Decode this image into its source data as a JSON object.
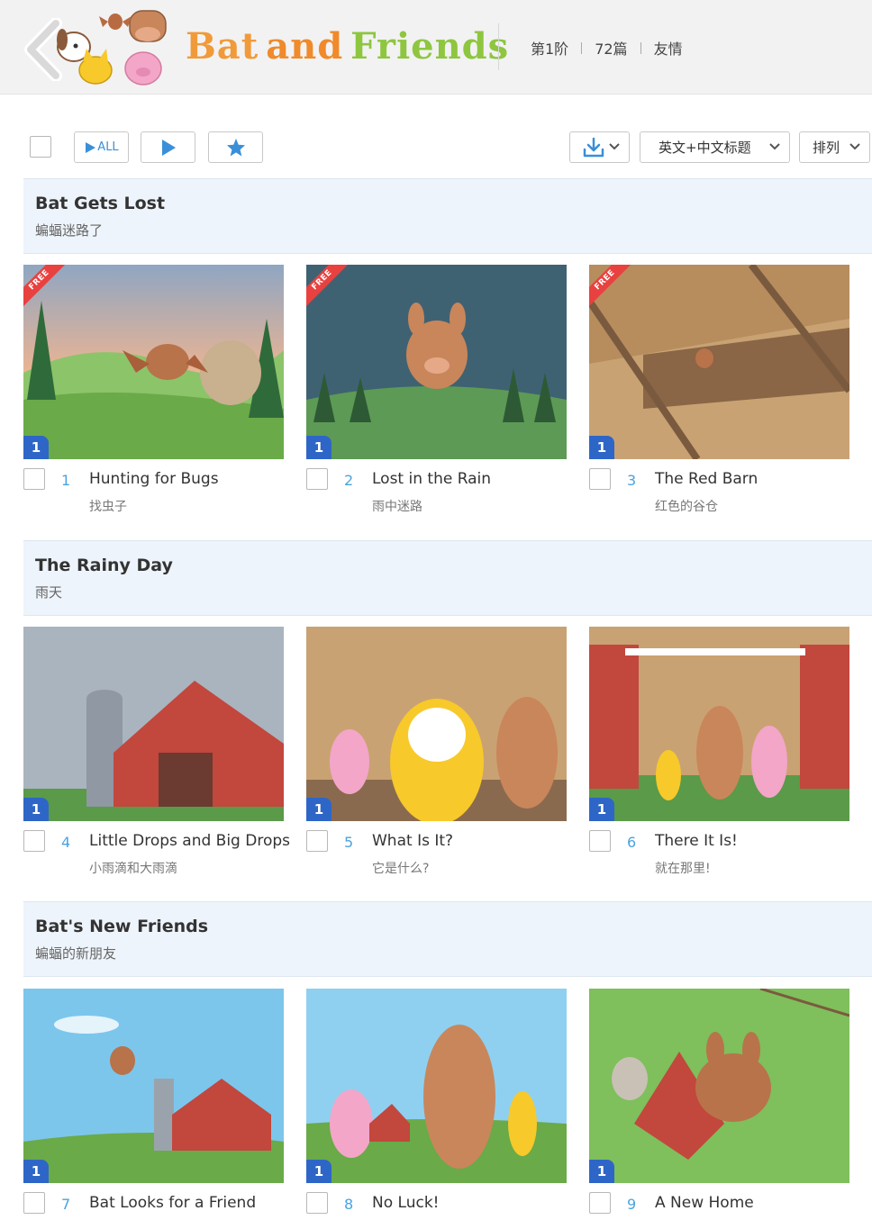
{
  "header": {
    "logo_word1": "Bat",
    "logo_word2": "and",
    "logo_word3": "Friends",
    "level": "第1阶",
    "count": "72篇",
    "theme": "友情"
  },
  "toolbar": {
    "all_label": "ALL",
    "language_label": "英文+中文标题",
    "sort_label": "排列"
  },
  "colors": {
    "accent_blue": "#3a8fd8",
    "level_badge": "#2e66c8",
    "free_ribbon": "#e8413f",
    "section_bg": "#eef4fb"
  },
  "sections": [
    {
      "title": "Bat Gets Lost",
      "subtitle": "蝙蝠迷路了",
      "items": [
        {
          "num": "1",
          "level": "1",
          "free": "FREE",
          "title": "Hunting for Bugs",
          "subtitle": "找虫子"
        },
        {
          "num": "2",
          "level": "1",
          "free": "FREE",
          "title": "Lost in the Rain",
          "subtitle": "雨中迷路"
        },
        {
          "num": "3",
          "level": "1",
          "free": "FREE",
          "title": "The Red Barn",
          "subtitle": "红色的谷仓"
        }
      ]
    },
    {
      "title": "The Rainy Day",
      "subtitle": "雨天",
      "items": [
        {
          "num": "4",
          "level": "1",
          "title": "Little Drops and Big Drops",
          "subtitle": "小雨滴和大雨滴"
        },
        {
          "num": "5",
          "level": "1",
          "title": "What Is It?",
          "subtitle": "它是什么?"
        },
        {
          "num": "6",
          "level": "1",
          "title": "There It Is!",
          "subtitle": "就在那里!"
        }
      ]
    },
    {
      "title": "Bat's New Friends",
      "subtitle": "蝙蝠的新朋友",
      "items": [
        {
          "num": "7",
          "level": "1",
          "title": "Bat Looks for a Friend",
          "subtitle": ""
        },
        {
          "num": "8",
          "level": "1",
          "title": "No Luck!",
          "subtitle": ""
        },
        {
          "num": "9",
          "level": "1",
          "title": "A New Home",
          "subtitle": ""
        }
      ]
    }
  ]
}
